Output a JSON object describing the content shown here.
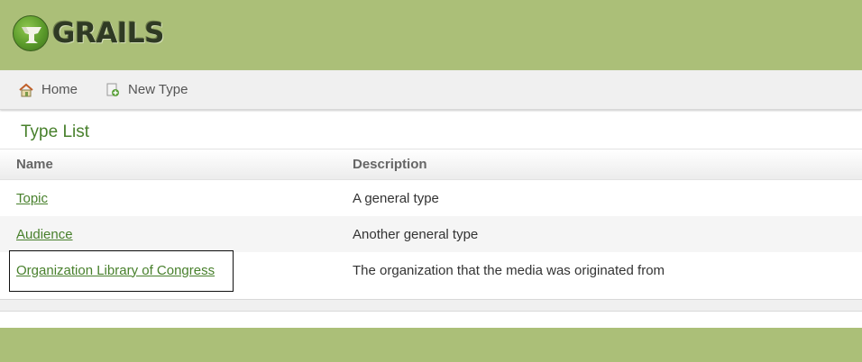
{
  "header": {
    "logo_text": "GRAILS",
    "brand_color": "#abbf78"
  },
  "nav": {
    "home_label": "Home",
    "new_label": "New Type"
  },
  "page": {
    "title": "Type List"
  },
  "table": {
    "columns": [
      "Name",
      "Description"
    ],
    "rows": [
      {
        "name": "Topic",
        "description": "A general type"
      },
      {
        "name": "Audience",
        "description": "Another general type"
      },
      {
        "name": "Organization Library of Congress",
        "description": "The organization that the media was originated from"
      }
    ]
  },
  "colors": {
    "link": "#48802c",
    "title": "#48802c"
  }
}
